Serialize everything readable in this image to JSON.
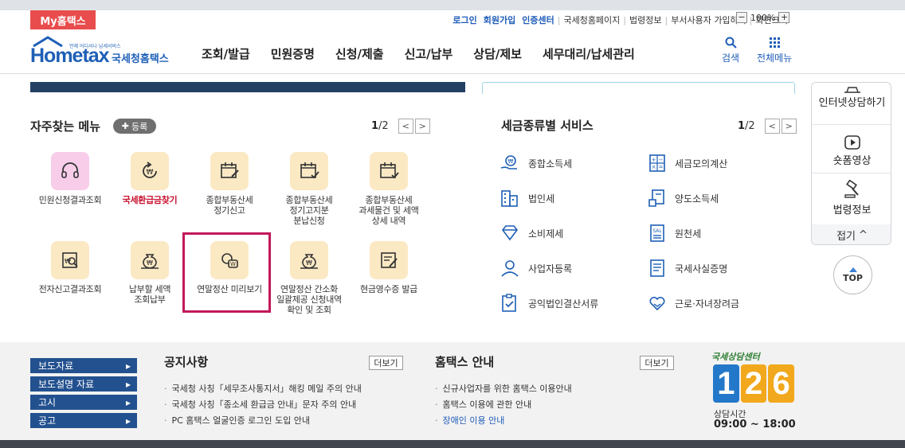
{
  "top": {
    "myhome": "My홈택스",
    "util": [
      "로그인",
      "회원가입",
      "인증센터",
      "국세청홈페이지",
      "법령정보",
      "부서사용자 가입하기",
      "화면크기"
    ],
    "zoom_minus": "−",
    "zoom_value": "100%",
    "zoom_plus": "+"
  },
  "logo": {
    "text_home": "Hometax",
    "text_small": "언제 어디서나 납세서비스",
    "text_nts": "국세청홈택스"
  },
  "gnb": [
    "조회/발급",
    "민원증명",
    "신청/제출",
    "신고/납부",
    "상담/제보",
    "세무대리/납세관리"
  ],
  "header_icons": {
    "search": "검색",
    "allmenu": "전체메뉴"
  },
  "favorites": {
    "title": "자주찾는 메뉴",
    "register": "등록",
    "page_current": "1",
    "page_total": "/2",
    "items": [
      {
        "label": "민원신청결과조회",
        "icon": "headset-icon"
      },
      {
        "label": "국세환급금찾기",
        "icon": "refund-icon"
      },
      {
        "label": "종합부동산세\n정기신고",
        "icon": "calendar-pen-icon"
      },
      {
        "label": "종합부동산세\n정기고지분\n분납신청",
        "icon": "calendar-check-icon"
      },
      {
        "label": "종합부동산세\n과세물건 및 세액\n상세 내역",
        "icon": "calendar-list-icon"
      },
      {
        "label": "전자신고결과조회",
        "icon": "document-search-icon"
      },
      {
        "label": "납부할 세액\n조회납부",
        "icon": "money-bag-icon"
      },
      {
        "label": "연말정산 미리보기",
        "icon": "preview-coin-icon"
      },
      {
        "label": "연말정산 간소화\n일괄제공 신청내역\n확인 및 조회",
        "icon": "money-bag-icon"
      },
      {
        "label": "현금영수증 발급",
        "icon": "receipt-pen-icon"
      }
    ]
  },
  "tax_services": {
    "title": "세금종류별 서비스",
    "page_current": "1",
    "page_total": "/2",
    "items": [
      {
        "label": "종합소득세",
        "icon": "coin-hand-icon"
      },
      {
        "label": "세금모의계산",
        "icon": "calculator-icon"
      },
      {
        "label": "법인세",
        "icon": "building-icon"
      },
      {
        "label": "양도소득세",
        "icon": "transfer-doc-icon"
      },
      {
        "label": "소비제세",
        "icon": "diamond-icon"
      },
      {
        "label": "원천세",
        "icon": "salary-doc-icon"
      },
      {
        "label": "사업자등록",
        "icon": "person-icon"
      },
      {
        "label": "국세사실증명",
        "icon": "certificate-icon"
      },
      {
        "label": "공익법인결산서류",
        "icon": "clipboard-check-icon"
      },
      {
        "label": "근로·자녀장려금",
        "icon": "heart-hand-icon"
      }
    ]
  },
  "side": {
    "chat": "인터넷상담하기",
    "video": "숏폼영상",
    "law": "법령정보",
    "fold": "접기",
    "top": "TOP"
  },
  "bottom": {
    "nav": [
      "보도자료",
      "보도설명 자료",
      "고시",
      "공고"
    ],
    "notice_title": "공지사항",
    "notice_more": "더보기",
    "notices": [
      "국세청 사칭「세무조사통지서」해킹 메일 주의 안내",
      "국세청 사칭「종소세 환급금 안내」문자 주의 안내",
      "PC 홈택스 얼굴인증 로그인 도입 안내"
    ],
    "guide_title": "홈택스 안내",
    "guide_more": "더보기",
    "guides": [
      "신규사업자를 위한 홈택스 이용안내",
      "홈택스 이용에 관한 안내",
      "장애인 이용 안내"
    ],
    "callcenter_title": "국세상담센터",
    "callcenter_digits": [
      "1",
      "2",
      "6"
    ],
    "hours_label": "상담시간",
    "hours": "09:00 ~ 18:00"
  },
  "colors": {
    "brand_blue": "#1e5fb6",
    "navy": "#233f64",
    "highlight": "#c2185b",
    "myhome_red": "#e84c4c"
  }
}
